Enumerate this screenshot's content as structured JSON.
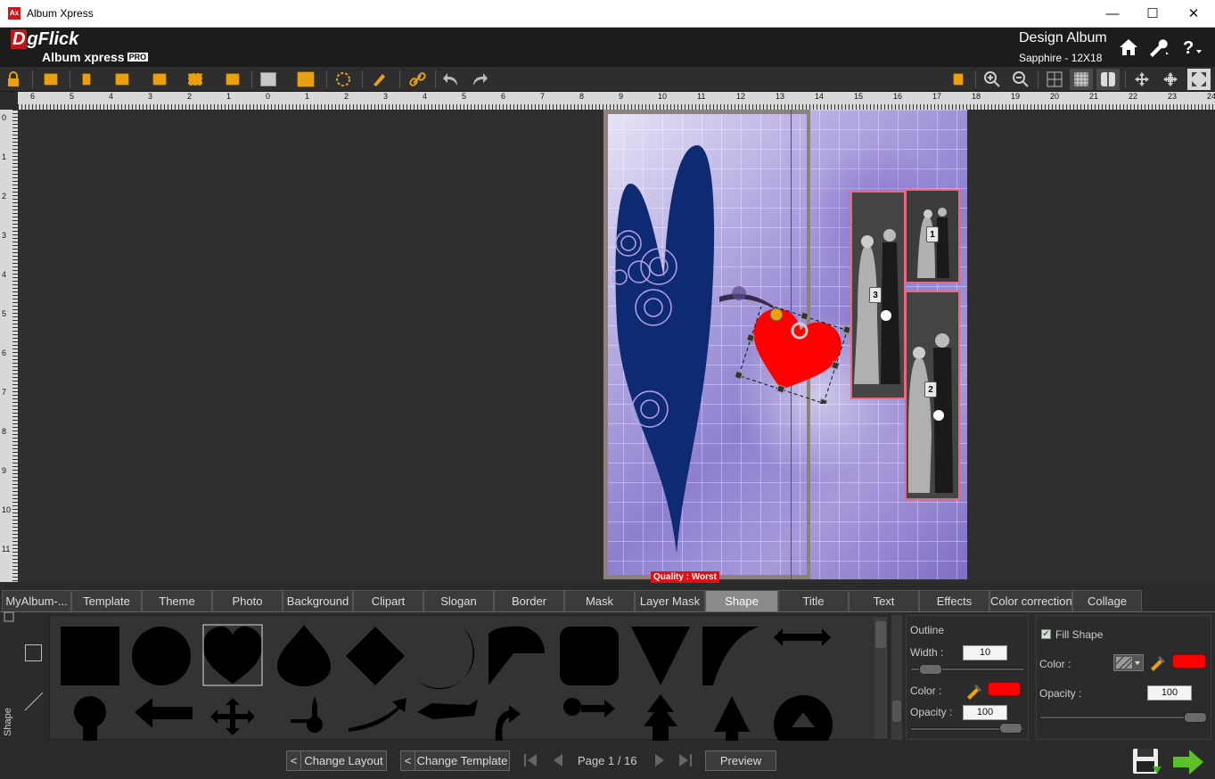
{
  "window": {
    "title": "Album Xpress",
    "app_icon": "Ax",
    "controls": [
      "—",
      "☐",
      "✕"
    ]
  },
  "brand": {
    "logo_main": "gFlick",
    "logo_d": "D",
    "product": "Album xpress",
    "badge": "PRO"
  },
  "header": {
    "mode": "Design Album",
    "album": "Sapphire - 12X18"
  },
  "ruler": {
    "h_ticks": [
      "6",
      "5",
      "4",
      "3",
      "2",
      "1",
      "0",
      "1",
      "2",
      "3",
      "4",
      "5",
      "6",
      "7",
      "8",
      "9",
      "10",
      "11",
      "12",
      "13",
      "14",
      "15",
      "16",
      "17",
      "18",
      "19",
      "20",
      "21",
      "22",
      "23",
      "24"
    ],
    "v_ticks": [
      "0",
      "1",
      "2",
      "3",
      "4",
      "5",
      "6",
      "7",
      "8",
      "9",
      "10",
      "11"
    ]
  },
  "canvas": {
    "quality": "Quality : Worst",
    "photo_numbers": [
      "1",
      "3",
      "2"
    ]
  },
  "tabs": [
    {
      "label": "MyAlbum-..."
    },
    {
      "label": "Template"
    },
    {
      "label": "Theme"
    },
    {
      "label": "Photo"
    },
    {
      "label": "Background"
    },
    {
      "label": "Clipart"
    },
    {
      "label": "Slogan"
    },
    {
      "label": "Border"
    },
    {
      "label": "Mask"
    },
    {
      "label": "Layer Mask"
    },
    {
      "label": "Shape"
    },
    {
      "label": "Title"
    },
    {
      "label": "Text"
    },
    {
      "label": "Effects"
    },
    {
      "label": "Color correction"
    },
    {
      "label": "Collage"
    }
  ],
  "active_tab": "Shape",
  "side_label": "Shape",
  "outline": {
    "title": "Outline",
    "width_label": "Width :",
    "width": "10",
    "color_label": "Color :",
    "color": "#ff0000",
    "opacity_label": "Opacity :",
    "opacity": "100"
  },
  "fill": {
    "checkbox_label": "Fill Shape",
    "checked": true,
    "color_label": "Color :",
    "color": "#ff0000",
    "opacity_label": "Opacity :",
    "opacity": "100"
  },
  "footer": {
    "change_layout": "Change Layout",
    "change_template": "Change Template",
    "page": "Page 1 / 16",
    "preview": "Preview",
    "lt": "<"
  }
}
